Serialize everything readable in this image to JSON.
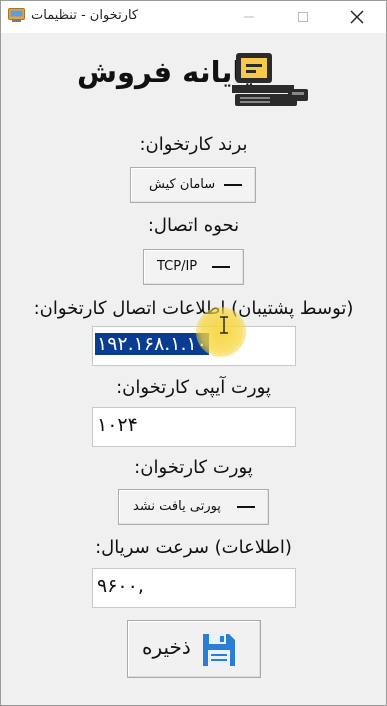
{
  "window": {
    "title": "کارتخوان - تنظیمات"
  },
  "header": {
    "title": "پایانه فروش",
    "icon": "pos-terminal-icon"
  },
  "form": {
    "brand_label": "برند کارتخوان:",
    "brand_value": "سامان کیش",
    "connection_label": "نحوه اتصال:",
    "connection_value": "TCP/IP",
    "ip_label": "(توسط پشتیبان) اطلاعات اتصال کارتخوان:",
    "ip_value": "۱۹۲.۱۶۸.۱.۱۰",
    "ip_port_label": "پورت آیپی کارتخوان:",
    "ip_port_value": "۱۰۲۴",
    "serial_port_label": "پورت کارتخوان:",
    "serial_port_value": "پورتی یافت نشد",
    "baud_label": "(اطلاعات) سرعت سریال:",
    "baud_value": "۹۶۰۰,"
  },
  "actions": {
    "save_label": "ذخیره",
    "save_icon": "floppy-disk-icon"
  },
  "colors": {
    "selection": "#0a3d91",
    "save_icon": "#2a7fd4",
    "cursor_highlight": "#f6d63c"
  }
}
